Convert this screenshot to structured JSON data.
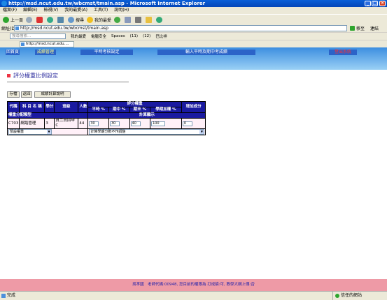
{
  "window": {
    "title": "http://msd.ncut.edu.tw/wbcmst/tmain.asp - Microsoft Internet Explorer"
  },
  "menu": [
    "檔案(F)",
    "編輯(E)",
    "檢視(V)",
    "我的最愛(A)",
    "工具(T)",
    "說明(H)"
  ],
  "toolbar": {
    "back": "上一頁",
    "search": "搜尋",
    "favorites": "我的最愛"
  },
  "address": {
    "label": "網址(D)",
    "url": "http://msd.ncut.edu.tw/wbcmst/tmain.asp",
    "go": "移至",
    "links": "連結"
  },
  "linksbar": {
    "search_placeholder": "搜尋搜索...",
    "items": [
      "我的最愛",
      "電腦安全",
      "Spaces",
      "(11)",
      "(12)",
      "巴比祥"
    ]
  },
  "favtab": {
    "label": "http://msd.ncut.edu...."
  },
  "sitenav": [
    "回首頁",
    "成績管理",
    "平時考核設定",
    "輸入平時及期中考成績",
    "登出系統"
  ],
  "page": {
    "title": "評分權重比例設定"
  },
  "buttons": {
    "save": "存檔",
    "back": "返回",
    "help": "成績計算說明"
  },
  "table": {
    "headers": {
      "code": "代碼",
      "course": "科 目 名 稱",
      "credits": "學分",
      "class": "班級",
      "count": "人數",
      "weight": "評分權重",
      "extra": "增加成分",
      "regular": "平時 %",
      "midterm": "期中 %",
      "final": "期末 %",
      "period_add": "學期加權 %",
      "calc": "計算顯示",
      "dist_type": "權重分配類型"
    },
    "row": {
      "code": "C703",
      "course": "網路管理",
      "credits": "3",
      "class": "資二資四甲C",
      "count": "44",
      "regular": "30",
      "midterm": "30",
      "final": "40",
      "total": "100",
      "extra": "0"
    },
    "select_weight": "預設權重",
    "select_calc": "計算學期分數不作調整"
  },
  "footer": {
    "text": "吳孝國　老師代碼:00948, 您目前的權限為 打成績:可, 教學大綱上傳:否"
  },
  "status": {
    "left": "完成",
    "zone": "信任的網站"
  }
}
